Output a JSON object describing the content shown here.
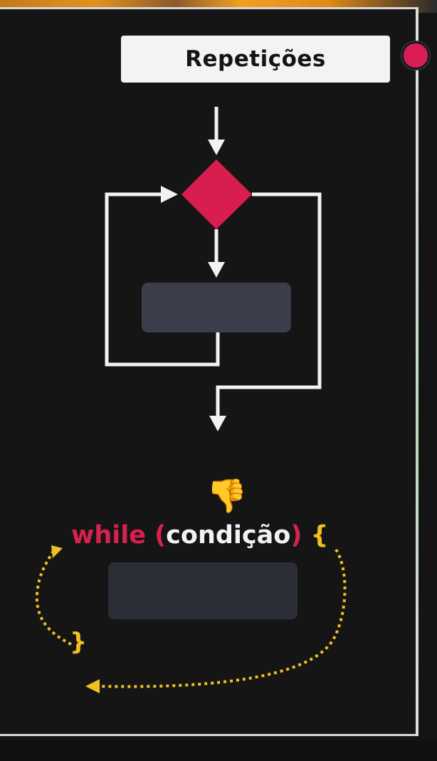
{
  "header": {
    "title": "Repetições"
  },
  "code": {
    "keyword": "while",
    "open_paren": "(",
    "condition": "condição",
    "close_paren": ")",
    "open_brace": "{",
    "close_brace": "}"
  },
  "icons": {
    "thumbs_down": "👎",
    "record": "record-dot-icon"
  },
  "colors": {
    "accent_red": "#d8214f",
    "brace_yellow": "#f0c020",
    "arrow_white": "#f2f2f2",
    "block_gray": "#3a3d4a",
    "background": "#151515"
  }
}
